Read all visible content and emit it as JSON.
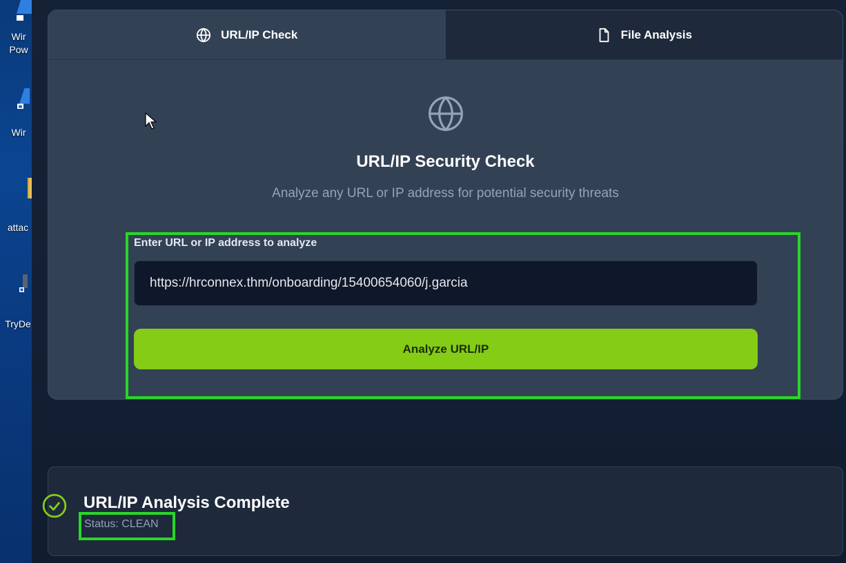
{
  "desktop": {
    "icons": [
      {
        "label_line1": "Wir",
        "label_line2": "Pow"
      },
      {
        "label_line1": "Wir",
        "label_line2": ""
      },
      {
        "label_line1": "attac",
        "label_line2": ""
      },
      {
        "label_line1": "TryDe",
        "label_line2": ""
      }
    ]
  },
  "tabs": {
    "url_check_label": "URL/IP Check",
    "file_analysis_label": "File Analysis",
    "active": "URL/IP Check"
  },
  "hero": {
    "icon": "globe-icon",
    "title": "URL/IP Security Check",
    "subtitle": "Analyze any URL or IP address for potential security threats"
  },
  "form": {
    "label": "Enter URL or IP address to analyze",
    "input_value": "https://hrconnex.thm/onboarding/15400654060/j.garcia",
    "button_label": "Analyze URL/IP"
  },
  "result": {
    "icon": "check-circle-icon",
    "title": "URL/IP Analysis Complete",
    "status": "Status: CLEAN"
  },
  "colors": {
    "accent": "#84cc16",
    "highlight": "#28d728",
    "card_bg": "#334155",
    "inactive_tab_bg": "#1e293b",
    "input_bg": "#0f172a"
  }
}
